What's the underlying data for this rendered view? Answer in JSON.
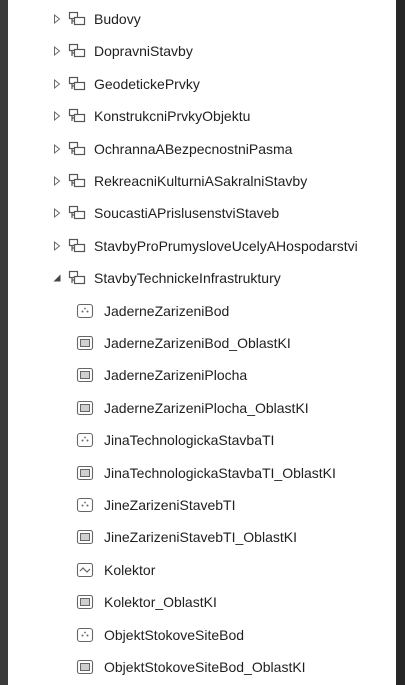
{
  "tree": {
    "groups": [
      {
        "label": "Budovy",
        "expanded": false,
        "icon": "group-layer-icon"
      },
      {
        "label": "DopravniStavby",
        "expanded": false,
        "icon": "group-layer-icon"
      },
      {
        "label": "GeodetickePrvky",
        "expanded": false,
        "icon": "group-layer-icon"
      },
      {
        "label": "KonstrukcniPrvkyObjektu",
        "expanded": false,
        "icon": "group-layer-icon"
      },
      {
        "label": "OchrannaABezpecnostniPasma",
        "expanded": false,
        "icon": "group-layer-icon"
      },
      {
        "label": "RekreacniKulturniASakralniStavby",
        "expanded": false,
        "icon": "group-layer-icon"
      },
      {
        "label": "SoucastiAPrislusenstviStaveb",
        "expanded": false,
        "icon": "group-layer-icon"
      },
      {
        "label": "StavbyProPrumysloveUcelyAHospodarstvi",
        "expanded": false,
        "icon": "group-layer-icon"
      },
      {
        "label": "StavbyTechnickeInfrastruktury",
        "expanded": true,
        "icon": "group-layer-icon"
      }
    ],
    "children": [
      {
        "label": "JaderneZarizeniBod",
        "icon": "point-layer-icon"
      },
      {
        "label": "JaderneZarizeniBod_OblastKI",
        "icon": "polygon-layer-icon"
      },
      {
        "label": "JaderneZarizeniPlocha",
        "icon": "polygon-layer-icon"
      },
      {
        "label": "JaderneZarizeniPlocha_OblastKI",
        "icon": "polygon-layer-icon"
      },
      {
        "label": "JinaTechnologickaStavbaTI",
        "icon": "point-layer-icon"
      },
      {
        "label": "JinaTechnologickaStavbaTI_OblastKI",
        "icon": "polygon-layer-icon"
      },
      {
        "label": "JineZarizeniStavebTI",
        "icon": "point-layer-icon"
      },
      {
        "label": "JineZarizeniStavebTI_OblastKI",
        "icon": "polygon-layer-icon"
      },
      {
        "label": "Kolektor",
        "icon": "line-layer-icon"
      },
      {
        "label": "Kolektor_OblastKI",
        "icon": "polygon-layer-icon"
      },
      {
        "label": "ObjektStokoveSiteBod",
        "icon": "point-layer-icon"
      },
      {
        "label": "ObjektStokoveSiteBod_OblastKI",
        "icon": "polygon-layer-icon"
      }
    ]
  }
}
